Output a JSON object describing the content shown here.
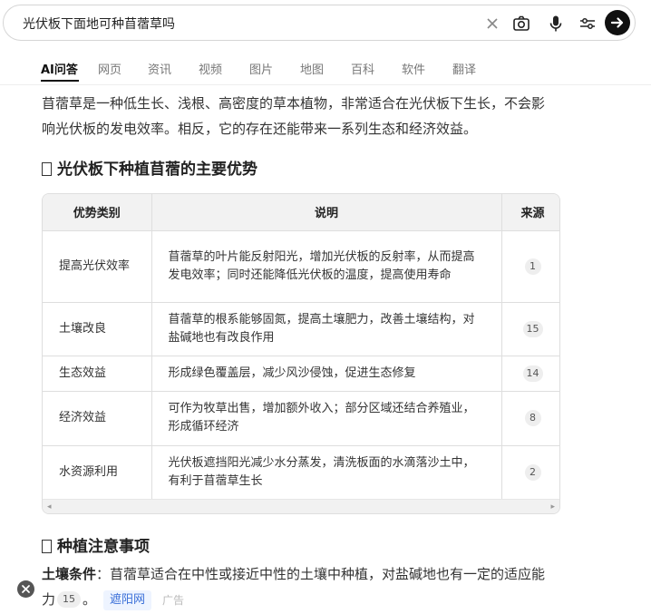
{
  "search": {
    "query": "光伏板下面地可种苜蓿草吗"
  },
  "icons": {
    "clear": "close-icon",
    "camera": "camera-icon",
    "mic": "microphone-icon",
    "filter": "filter-sliders-icon",
    "go": "arrow-right-icon"
  },
  "tabs": [
    {
      "label": "AI问答",
      "active": true
    },
    {
      "label": "网页"
    },
    {
      "label": "资讯"
    },
    {
      "label": "视频"
    },
    {
      "label": "图片"
    },
    {
      "label": "地图"
    },
    {
      "label": "百科"
    },
    {
      "label": "软件"
    },
    {
      "label": "翻译"
    }
  ],
  "answer": {
    "intro": "苜蓿草是一种低生长、浅根、高密度的草本植物，非常适合在光伏板下生长，不会影响光伏板的发电效率。相反，它的存在还能带来一系列生态和经济效益。",
    "section1_title": "光伏板下种植苜蓿的主要优势",
    "table": {
      "headers": [
        "优势类别",
        "说明",
        "来源"
      ],
      "rows": [
        {
          "category": "提高光伏效率",
          "desc": "苜蓿草的叶片能反射阳光，增加光伏板的反射率，从而提高发电效率；同时还能降低光伏板的温度，提高使用寿命",
          "source": "1"
        },
        {
          "category": "土壤改良",
          "desc": "苜蓿草的根系能够固氮，提高土壤肥力，改善土壤结构，对盐碱地也有改良作用",
          "source": "15"
        },
        {
          "category": "生态效益",
          "desc": "形成绿色覆盖层，减少风沙侵蚀，促进生态修复",
          "source": "14"
        },
        {
          "category": "经济效益",
          "desc": "可作为牧草出售，增加额外收入；部分区域还结合养殖业，形成循环经济",
          "source": "8"
        },
        {
          "category": "水资源利用",
          "desc": "光伏板遮挡阳光减少水分蒸发，清洗板面的水滴落沙土中，有利于苜蓿草生长",
          "source": "2"
        }
      ]
    },
    "section2_title": "种植注意事项",
    "soil": {
      "label": "土壤条件",
      "text": "：苜蓿草适合在中性或接近中性的土壤中种植，对盐碱地也有一定的适应能力",
      "ref": "15",
      "after": "。",
      "link": "遮阳网",
      "ad": "广告"
    }
  },
  "colors": {
    "accent_link": "#3a6fd8",
    "go_button": "#111111"
  }
}
